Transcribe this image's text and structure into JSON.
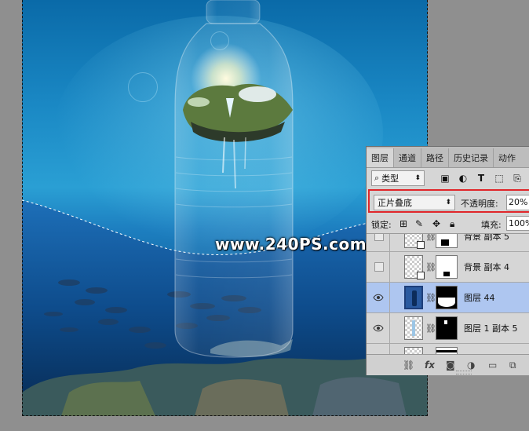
{
  "watermark": "www.240PS.com",
  "panel": {
    "tabs": [
      "图层",
      "通道",
      "路径",
      "历史记录",
      "动作"
    ],
    "filter": {
      "kind_label": "类型",
      "icons": [
        "image-filter-icon",
        "adjustment-filter-icon",
        "type-filter-icon",
        "shape-filter-icon",
        "smart-object-filter-icon"
      ]
    },
    "blend_mode": "正片叠底",
    "opacity_label": "不透明度:",
    "opacity_value": "20%",
    "lock_label": "锁定:",
    "fill_label": "填充:",
    "fill_value": "100%",
    "layers": [
      {
        "name": "背景 副本 5",
        "visible": false,
        "selected": false
      },
      {
        "name": "背景 副本 4",
        "visible": false,
        "selected": false
      },
      {
        "name": "图层 44",
        "visible": true,
        "selected": true
      },
      {
        "name": "图层 1 副本 5",
        "visible": true,
        "selected": false
      }
    ],
    "bottom_icons": [
      "link-layers-icon",
      "fx-icon",
      "add-mask-icon",
      "adjustment-layer-icon",
      "new-group-icon",
      "new-layer-icon"
    ],
    "fx_label": "fx"
  }
}
